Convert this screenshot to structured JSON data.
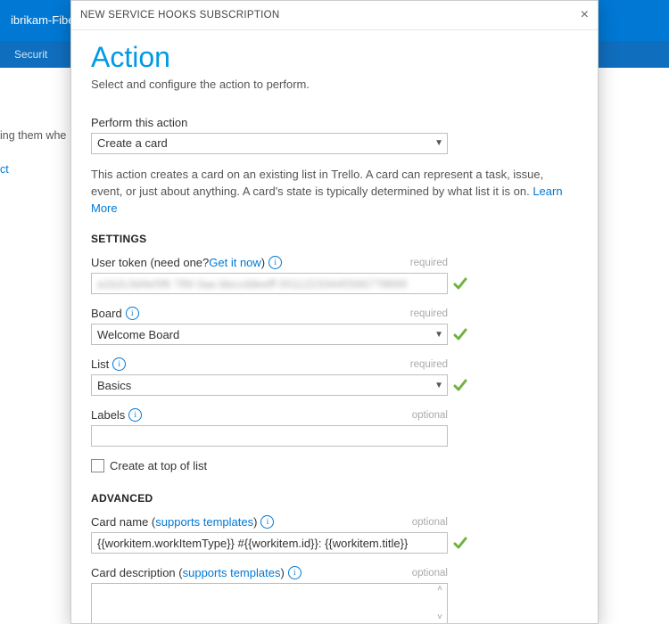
{
  "background": {
    "project_name": "ibrikam-Fiber",
    "subnav_tab": "Securit",
    "body_fragment": "ing them whe",
    "link_fragment": "ct"
  },
  "modal": {
    "header_title": "NEW SERVICE HOOKS SUBSCRIPTION",
    "close_glyph": "×",
    "title": "Action",
    "subtitle": "Select and configure the action to perform.",
    "perform_action": {
      "label": "Perform this action",
      "value": "Create a card"
    },
    "action_description": "This action creates a card on an existing list in Trello. A card can represent a task, issue, event, or just about anything. A card's state is typically determined by what list it is on.",
    "learn_more": "Learn More",
    "settings_heading": "SETTINGS",
    "hints": {
      "required": "required",
      "optional": "optional"
    },
    "user_token": {
      "label_pre": "User token (need one? ",
      "get_it_now": "Get it now",
      "label_post": ")",
      "masked_value": "a1b2c3d4e5f6 789 0aa bbccddeeff 00112233445566778899",
      "valid": true
    },
    "board": {
      "label": "Board",
      "value": "Welcome Board",
      "valid": true
    },
    "list": {
      "label": "List",
      "value": "Basics",
      "valid": true
    },
    "labels": {
      "label": "Labels",
      "value": ""
    },
    "create_top": {
      "label": "Create at top of list",
      "checked": false
    },
    "advanced_heading": "ADVANCED",
    "supports_templates": "supports templates",
    "card_name": {
      "label": "Card name",
      "value": "{{workitem.workItemType}} #{{workitem.id}}: {{workitem.title}}",
      "valid": true
    },
    "card_description": {
      "label": "Card description",
      "value": ""
    }
  }
}
